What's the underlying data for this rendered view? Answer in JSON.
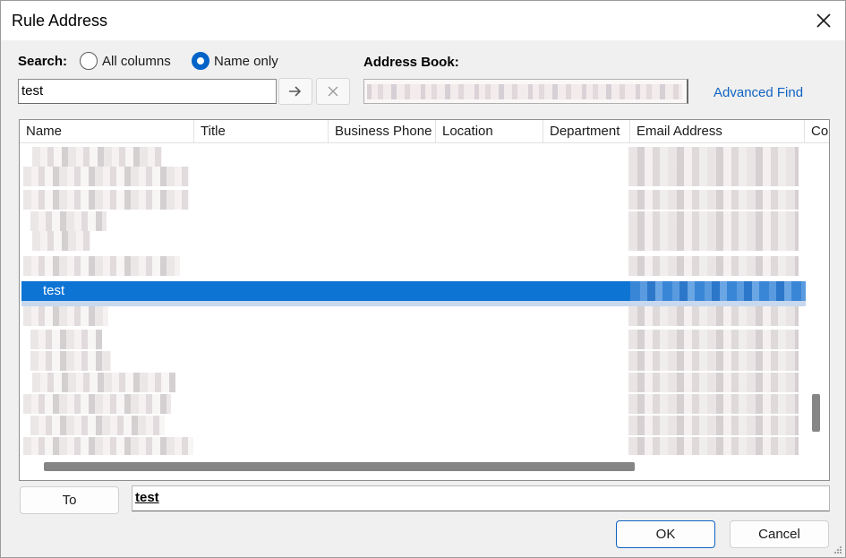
{
  "window": {
    "title": "Rule Address"
  },
  "search": {
    "label": "Search:",
    "option_all": "All columns",
    "option_name": "Name only",
    "selected_option": "Name only",
    "value": "test"
  },
  "address_book": {
    "label": "Address Book:"
  },
  "advanced_find": "Advanced Find",
  "columns": [
    "Name",
    "Title",
    "Business Phone",
    "Location",
    "Department",
    "Email Address",
    "Co"
  ],
  "list": {
    "selected_name": "test"
  },
  "to": {
    "button_label": "To",
    "value": "test"
  },
  "buttons": {
    "ok": "OK",
    "cancel": "Cancel"
  },
  "colors": {
    "accent": "#0063c8",
    "selection": "#0d74d4",
    "link": "#0f64c2"
  },
  "icons": {
    "close": "close-icon",
    "go": "arrow-right-icon",
    "clear": "clear-x-icon"
  }
}
